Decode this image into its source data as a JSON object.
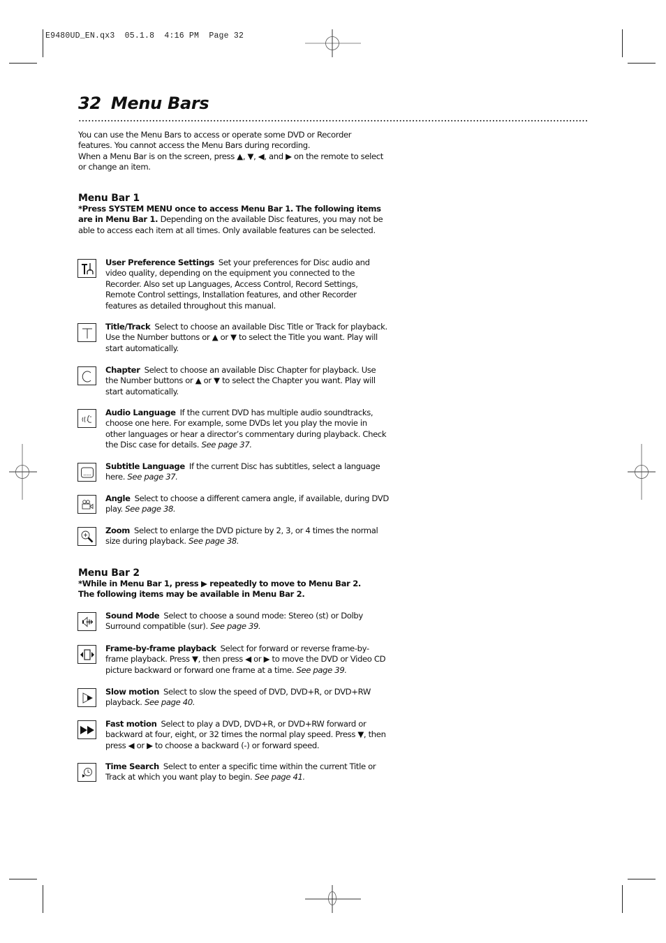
{
  "slug": "E9480UD_EN.qx3  05.1.8  4:16 PM  Page 32",
  "header": {
    "page_number": "32",
    "title": "Menu Bars"
  },
  "intro": {
    "line1": "You can use the Menu Bars to access or operate some DVD or Recorder features. You cannot access the Menu Bars during recording.",
    "line2_pre": "When a Menu Bar is on the screen, press ",
    "arrows": {
      "up": "▲",
      "down": "▼",
      "left": "◀",
      "right": "▶"
    },
    "line2_post": " on the remote to select or change an item."
  },
  "menu_bar_1": {
    "heading": "Menu Bar 1",
    "instruction_bold": "*Press SYSTEM MENU once to access Menu Bar 1. The following items are in Menu Bar 1.",
    "instruction_rest": " Depending on the available Disc features, you may not be able to access each item at all times. Only available features can be selected.",
    "items": [
      {
        "icon": "user-preference-settings-icon",
        "name": "User Preference Settings",
        "text": "Set your preferences for Disc audio and video quality, depending on the equipment you connected to the Recorder. Also set up Languages, Access Control, Record Settings, Remote Control settings, Installation features, and other Recorder features as detailed throughout this manual.",
        "see": ""
      },
      {
        "icon": "title-track-icon",
        "name": "Title/Track",
        "text": "Select to choose an available Disc Title or Track for playback. Use the Number buttons or ▲ or ▼ to select the Title you want. Play will start automatically.",
        "see": ""
      },
      {
        "icon": "chapter-icon",
        "name": "Chapter",
        "text": "Select to choose an available Disc Chapter for playback. Use the Number buttons or ▲ or ▼ to select the Chapter you want. Play will start automatically.",
        "see": ""
      },
      {
        "icon": "audio-language-icon",
        "name": "Audio Language",
        "text": "If the current DVD has multiple audio soundtracks, choose one here. For example, some DVDs let you play the movie in other languages or hear a director’s commentary during playback. Check the Disc case for details.",
        "see": "See page 37."
      },
      {
        "icon": "subtitle-language-icon",
        "name": "Subtitle Language",
        "text": "If the current Disc has subtitles, select a language here.",
        "see": "See page 37."
      },
      {
        "icon": "angle-camera-icon",
        "name": "Angle",
        "text": "Select to choose a different camera angle, if available, during DVD play.",
        "see": "See page 38."
      },
      {
        "icon": "zoom-icon",
        "name": "Zoom",
        "text": "Select to enlarge the DVD picture by 2, 3, or 4 times the normal size during playback.",
        "see": "See page 38."
      }
    ]
  },
  "menu_bar_2": {
    "heading": "Menu Bar 2",
    "instruction_bold": "*While in Menu Bar 1, press ▶ repeatedly to move to Menu Bar 2. The following items may be available in Menu Bar 2.",
    "items": [
      {
        "icon": "sound-mode-icon",
        "name": "Sound Mode",
        "text": "Select to choose a sound mode: Stereo (st) or Dolby Surround compatible (sur).",
        "see": "See page 39."
      },
      {
        "icon": "frame-by-frame-icon",
        "name": "Frame-by-frame playback",
        "text": "Select for forward or reverse frame-by-frame playback. Press ▼, then press ◀ or ▶ to move the DVD or Video CD picture backward or forward one frame at a time.",
        "see": "See page 39."
      },
      {
        "icon": "slow-motion-icon",
        "name": "Slow motion",
        "text": "Select to slow the speed of DVD, DVD+R, or DVD+RW playback.",
        "see": "See page 40."
      },
      {
        "icon": "fast-motion-icon",
        "name": "Fast motion",
        "text": "Select to play a DVD, DVD+R, or DVD+RW forward or backward at four, eight, or 32 times the normal play speed. Press ▼, then press ◀ or ▶ to choose a backward (-) or forward speed.",
        "see": ""
      },
      {
        "icon": "time-search-icon",
        "name": "Time Search",
        "text": "Select to enter a specific time within the current Title or Track at which you want play to begin.",
        "see": "See page 41."
      }
    ]
  }
}
